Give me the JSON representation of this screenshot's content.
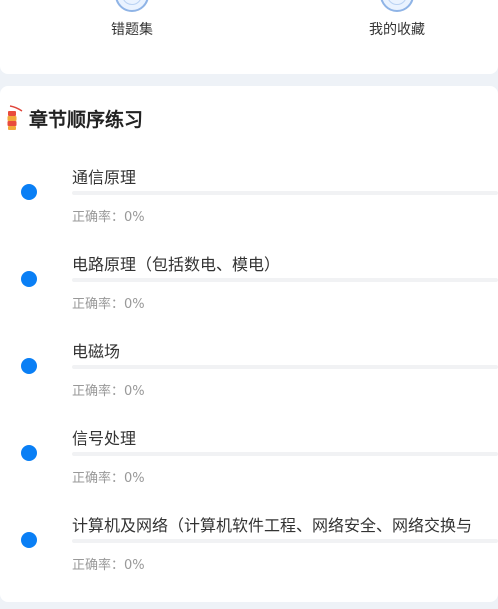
{
  "quick_entries": [
    {
      "label": "错题集",
      "icon": "wrong-questions-icon"
    },
    {
      "label": "我的收藏",
      "icon": "favorites-icon"
    }
  ],
  "chapter_section": {
    "title": "章节顺序练习",
    "icon": "firecracker-icon",
    "chapters": [
      {
        "title": "通信原理",
        "accuracy_label": "正确率：",
        "accuracy": "0%",
        "progress": 0
      },
      {
        "title": "电路原理（包括数电、模电）",
        "accuracy_label": "正确率：",
        "accuracy": "0%",
        "progress": 0
      },
      {
        "title": "电磁场",
        "accuracy_label": "正确率：",
        "accuracy": "0%",
        "progress": 0
      },
      {
        "title": "信号处理",
        "accuracy_label": "正确率：",
        "accuracy": "0%",
        "progress": 0
      },
      {
        "title": "计算机及网络（计算机软件工程、网络安全、网络交换与",
        "accuracy_label": "正确率：",
        "accuracy": "0%",
        "progress": 0
      }
    ]
  },
  "colors": {
    "accent": "#0a7ff5",
    "page_background": "#eef2f7",
    "muted_text": "#999999"
  }
}
